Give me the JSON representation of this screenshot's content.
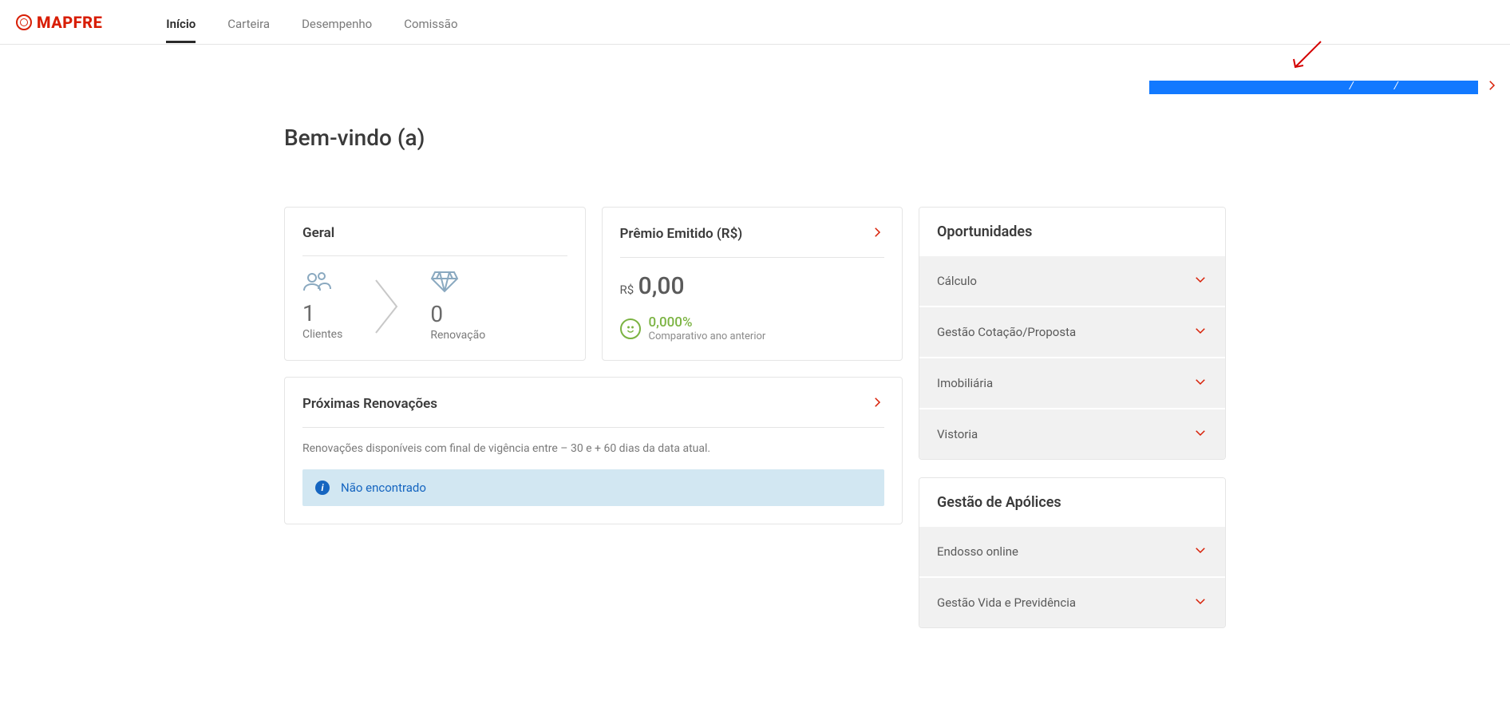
{
  "brand": "MAPFRE",
  "nav": {
    "items": [
      {
        "label": "Início",
        "active": true
      },
      {
        "label": "Carteira",
        "active": false
      },
      {
        "label": "Desempenho",
        "active": false
      },
      {
        "label": "Comissão",
        "active": false
      }
    ]
  },
  "selection_bar": {
    "slash1": "/",
    "slash2": "/"
  },
  "welcome": "Bem-vindo (a)",
  "geral": {
    "title": "Geral",
    "clientes": {
      "value": "1",
      "label": "Clientes"
    },
    "renovacao": {
      "value": "0",
      "label": "Renovação"
    }
  },
  "premio": {
    "title": "Prêmio Emitido (R$)",
    "currency": "R$",
    "value": "0,00",
    "pct": "0,000%",
    "compare_label": "Comparativo ano anterior"
  },
  "renovacoes": {
    "title": "Próximas Renovações",
    "desc": "Renovações disponíveis com final de vigência entre – 30 e + 60 dias da data atual.",
    "banner": "Não encontrado"
  },
  "oportunidades": {
    "title": "Oportunidades",
    "items": [
      "Cálculo",
      "Gestão Cotação/Proposta",
      "Imobiliária",
      "Vistoria"
    ]
  },
  "apolices": {
    "title": "Gestão de Apólices",
    "items": [
      "Endosso online",
      "Gestão Vida e Previdência"
    ]
  }
}
